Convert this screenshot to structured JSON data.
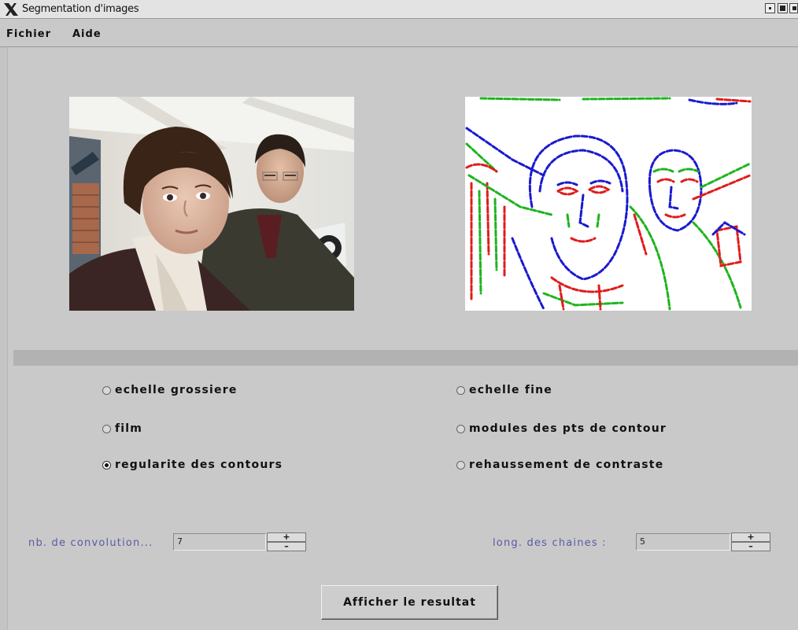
{
  "window": {
    "title": "Segmentation d'images"
  },
  "menu": {
    "items": [
      "Fichier",
      "Aide"
    ]
  },
  "options": {
    "left": [
      {
        "label": "echelle grossiere",
        "selected": false
      },
      {
        "label": "film",
        "selected": false
      },
      {
        "label": "regularite des contours",
        "selected": true
      }
    ],
    "right": [
      {
        "label": "echelle fine",
        "selected": false
      },
      {
        "label": "modules des pts de contour",
        "selected": false
      },
      {
        "label": "rehaussement de contraste",
        "selected": false
      }
    ]
  },
  "convolution": {
    "label": "nb. de convolution...",
    "value": "7",
    "plus": "+",
    "minus": "–"
  },
  "chain_length": {
    "label": "long. des chaines :",
    "value": "5",
    "plus": "+",
    "minus": "–"
  },
  "action": {
    "label": "Afficher le resultat"
  },
  "colors": {
    "window_bg": "#c9c9c9",
    "label_blue": "#5a5aa8",
    "edge_red": "#e01c1c",
    "edge_green": "#1fb41f",
    "edge_blue": "#1a1ad0"
  },
  "icons": {
    "app": "x11-logo-icon",
    "minimize": "minimize-icon",
    "maximize": "maximize-icon",
    "close": "close-icon"
  }
}
